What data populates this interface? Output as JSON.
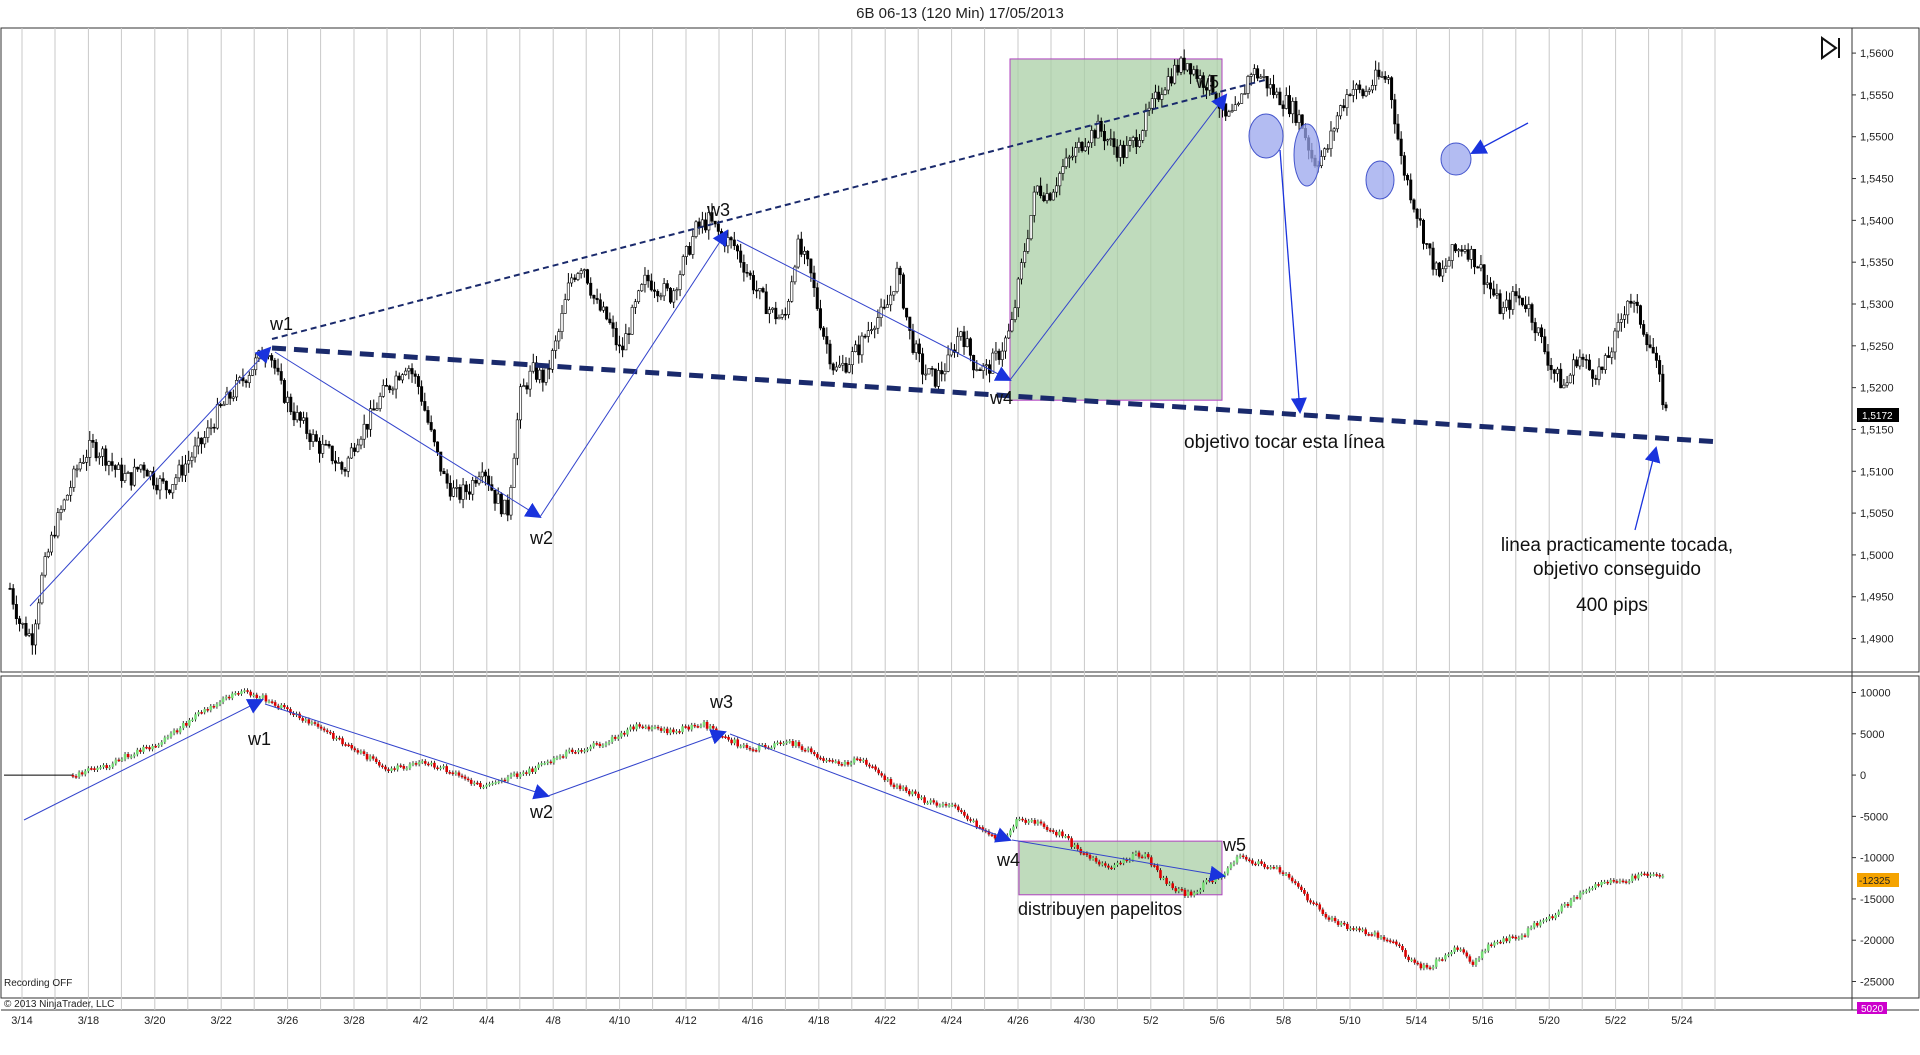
{
  "window": {
    "title": "6B 06-13 (120 Min)  17/05/2013",
    "recording": "Recording OFF",
    "copyright": "© 2013 NinjaTrader, LLC",
    "nav_icon": "jump-to-end-icon"
  },
  "colors": {
    "grid": "#c8c8c8",
    "candle_up": "#ffffff",
    "candle_down": "#000000",
    "trend_line": "#1a2a6c",
    "wave_line": "#3344cc",
    "arrow": "#1a33dd",
    "box_fill": "#a9cfa5",
    "box_stroke": "#b040c0",
    "ellipse": "#9aa6ee",
    "price_badge": "#000000",
    "vol_badge": "#f5a300",
    "bottom_badge": "#cc00cc",
    "hist_up": "#77dd77",
    "hist_down": "#dd0000"
  },
  "chart_data": [
    {
      "type": "candlestick",
      "instrument": "6B 06-13",
      "timeframe": "120 Min",
      "ylim": [
        1.486,
        1.563
      ],
      "y_ticks": [
        "1,4900",
        "1,4950",
        "1,5000",
        "1,5050",
        "1,5100",
        "1,5150",
        "1,5200",
        "1,5250",
        "1,5300",
        "1,5350",
        "1,5400",
        "1,5450",
        "1,5500",
        "1,5550",
        "1,5600"
      ],
      "y_tick_values": [
        1.49,
        1.495,
        1.5,
        1.505,
        1.51,
        1.515,
        1.52,
        1.525,
        1.53,
        1.535,
        1.54,
        1.545,
        1.55,
        1.555,
        1.56
      ],
      "last_price": "1,5172",
      "x_ticks": [
        "3/14",
        "3/18",
        "3/20",
        "3/22",
        "3/26",
        "3/28",
        "4/2",
        "4/4",
        "4/8",
        "4/10",
        "4/12",
        "4/16",
        "4/18",
        "4/22",
        "4/24",
        "4/26",
        "4/30",
        "5/2",
        "5/6",
        "5/8",
        "5/10",
        "5/14",
        "5/16",
        "5/20",
        "5/22",
        "5/24"
      ],
      "close_path": [
        [
          0,
          1.496
        ],
        [
          0.3,
          1.492
        ],
        [
          0.7,
          1.49
        ],
        [
          1,
          1.497
        ],
        [
          1.4,
          1.503
        ],
        [
          1.8,
          1.507
        ],
        [
          2.2,
          1.511
        ],
        [
          2.6,
          1.513
        ],
        [
          3,
          1.512
        ],
        [
          3.4,
          1.51
        ],
        [
          3.8,
          1.509
        ],
        [
          4.2,
          1.511
        ],
        [
          4.6,
          1.509
        ],
        [
          5,
          1.508
        ],
        [
          5.4,
          1.51
        ],
        [
          5.8,
          1.512
        ],
        [
          6.2,
          1.514
        ],
        [
          6.6,
          1.517
        ],
        [
          7,
          1.519
        ],
        [
          7.4,
          1.521
        ],
        [
          7.8,
          1.523
        ],
        [
          8.2,
          1.525
        ],
        [
          8.6,
          1.52
        ],
        [
          9,
          1.517
        ],
        [
          9.4,
          1.515
        ],
        [
          9.8,
          1.513
        ],
        [
          10.2,
          1.512
        ],
        [
          10.6,
          1.51
        ],
        [
          11,
          1.514
        ],
        [
          11.4,
          1.516
        ],
        [
          11.8,
          1.519
        ],
        [
          12.2,
          1.521
        ],
        [
          12.6,
          1.523
        ],
        [
          13,
          1.52
        ],
        [
          13.4,
          1.514
        ],
        [
          13.8,
          1.509
        ],
        [
          14.2,
          1.507
        ],
        [
          14.6,
          1.508
        ],
        [
          15,
          1.511
        ],
        [
          15.4,
          1.507
        ],
        [
          15.8,
          1.505
        ],
        [
          16.2,
          1.519
        ],
        [
          16.6,
          1.522
        ],
        [
          17,
          1.521
        ],
        [
          17.4,
          1.526
        ],
        [
          17.8,
          1.533
        ],
        [
          18.2,
          1.535
        ],
        [
          18.6,
          1.53
        ],
        [
          19,
          1.528
        ],
        [
          19.4,
          1.524
        ],
        [
          19.8,
          1.529
        ],
        [
          20.2,
          1.533
        ],
        [
          20.6,
          1.532
        ],
        [
          21,
          1.531
        ],
        [
          21.4,
          1.535
        ],
        [
          21.8,
          1.539
        ],
        [
          22.2,
          1.54
        ],
        [
          22.6,
          1.538
        ],
        [
          23,
          1.537
        ],
        [
          23.4,
          1.534
        ],
        [
          23.8,
          1.531
        ],
        [
          24.2,
          1.529
        ],
        [
          24.6,
          1.528
        ],
        [
          25,
          1.537
        ],
        [
          25.4,
          1.534
        ],
        [
          25.8,
          1.527
        ],
        [
          26.2,
          1.522
        ],
        [
          26.6,
          1.523
        ],
        [
          27,
          1.525
        ],
        [
          27.4,
          1.528
        ],
        [
          27.8,
          1.529
        ],
        [
          28.2,
          1.534
        ],
        [
          28.6,
          1.526
        ],
        [
          29,
          1.522
        ],
        [
          29.4,
          1.521
        ],
        [
          29.8,
          1.523
        ],
        [
          30.2,
          1.527
        ],
        [
          30.6,
          1.523
        ],
        [
          31,
          1.522
        ],
        [
          31.4,
          1.524
        ],
        [
          31.8,
          1.527
        ],
        [
          32.2,
          1.536
        ],
        [
          32.6,
          1.544
        ],
        [
          33,
          1.543
        ],
        [
          33.4,
          1.546
        ],
        [
          33.8,
          1.548
        ],
        [
          34.2,
          1.55
        ],
        [
          34.6,
          1.551
        ],
        [
          35,
          1.549
        ],
        [
          35.4,
          1.548
        ],
        [
          35.8,
          1.55
        ],
        [
          36.2,
          1.553
        ],
        [
          36.6,
          1.556
        ],
        [
          37,
          1.558
        ],
        [
          37.4,
          1.559
        ],
        [
          37.8,
          1.557
        ],
        [
          38.2,
          1.556
        ],
        [
          38.6,
          1.552
        ],
        [
          39,
          1.553
        ],
        [
          39.4,
          1.558
        ],
        [
          39.8,
          1.557
        ],
        [
          40.2,
          1.555
        ],
        [
          40.6,
          1.554
        ],
        [
          41,
          1.552
        ],
        [
          41.4,
          1.547
        ],
        [
          41.8,
          1.548
        ],
        [
          42.2,
          1.553
        ],
        [
          42.6,
          1.556
        ],
        [
          43,
          1.555
        ],
        [
          43.4,
          1.557
        ],
        [
          43.8,
          1.557
        ],
        [
          44.2,
          1.547
        ],
        [
          44.6,
          1.542
        ],
        [
          45,
          1.537
        ],
        [
          45.4,
          1.533
        ],
        [
          45.8,
          1.536
        ],
        [
          46.2,
          1.537
        ],
        [
          46.6,
          1.535
        ],
        [
          47,
          1.532
        ],
        [
          47.4,
          1.529
        ],
        [
          47.8,
          1.531
        ],
        [
          48.2,
          1.53
        ],
        [
          48.6,
          1.526
        ],
        [
          49,
          1.522
        ],
        [
          49.4,
          1.52
        ],
        [
          49.8,
          1.524
        ],
        [
          50.2,
          1.522
        ],
        [
          50.6,
          1.522
        ],
        [
          51,
          1.526
        ],
        [
          51.4,
          1.531
        ],
        [
          51.8,
          1.528
        ],
        [
          52.2,
          1.524
        ],
        [
          52.6,
          1.517
        ]
      ],
      "annotations": {
        "w1": "w1",
        "w2": "w2",
        "w3": "w3",
        "w4": "w4",
        "w5": "w5",
        "target_label": "objetivo tocar esta línea",
        "result_line1": "linea practicamente tocada,",
        "result_line2": "objetivo conseguido",
        "pips": "400 pips"
      }
    },
    {
      "type": "histogram",
      "ylim": [
        -27000,
        12000
      ],
      "y_ticks": [
        "10000",
        "5000",
        "0",
        "-5000",
        "-10000",
        "-15000",
        "-20000",
        "-25000"
      ],
      "y_tick_values": [
        10000,
        5000,
        0,
        -5000,
        -10000,
        -15000,
        -20000,
        -25000
      ],
      "last_value": "-12325",
      "bottom_badge": "5020",
      "path": [
        [
          0,
          0
        ],
        [
          1,
          0
        ],
        [
          2,
          0
        ],
        [
          2.5,
          500
        ],
        [
          3,
          1000
        ],
        [
          3.5,
          2000
        ],
        [
          4,
          2800
        ],
        [
          4.5,
          3500
        ],
        [
          5,
          4500
        ],
        [
          5.5,
          6000
        ],
        [
          6,
          7500
        ],
        [
          6.5,
          8500
        ],
        [
          7,
          9500
        ],
        [
          7.5,
          10000
        ],
        [
          8,
          9500
        ],
        [
          8.5,
          8500
        ],
        [
          9,
          7500
        ],
        [
          9.5,
          6500
        ],
        [
          10,
          5500
        ],
        [
          10.5,
          4000
        ],
        [
          11,
          3000
        ],
        [
          11.5,
          1800
        ],
        [
          12,
          800
        ],
        [
          12.5,
          1000
        ],
        [
          13,
          1800
        ],
        [
          13.5,
          1200
        ],
        [
          14,
          400
        ],
        [
          14.5,
          -500
        ],
        [
          15,
          -1500
        ],
        [
          15.5,
          -1000
        ],
        [
          16,
          0
        ],
        [
          16.5,
          500
        ],
        [
          17,
          1500
        ],
        [
          17.5,
          2500
        ],
        [
          18,
          3000
        ],
        [
          18.5,
          3500
        ],
        [
          19,
          4200
        ],
        [
          19.5,
          5200
        ],
        [
          20,
          6000
        ],
        [
          20.5,
          5800
        ],
        [
          21,
          5200
        ],
        [
          21.5,
          5800
        ],
        [
          22,
          6200
        ],
        [
          22.5,
          5000
        ],
        [
          23,
          4000
        ],
        [
          23.5,
          3200
        ],
        [
          24,
          3500
        ],
        [
          24.5,
          4000
        ],
        [
          25,
          3800
        ],
        [
          25.5,
          2500
        ],
        [
          26,
          1500
        ],
        [
          26.5,
          1500
        ],
        [
          27,
          2000
        ],
        [
          27.5,
          500
        ],
        [
          28,
          -1000
        ],
        [
          28.5,
          -2000
        ],
        [
          29,
          -3000
        ],
        [
          29.5,
          -3500
        ],
        [
          30,
          -4000
        ],
        [
          30.5,
          -5500
        ],
        [
          31,
          -7000
        ],
        [
          31.5,
          -8000
        ],
        [
          32,
          -5500
        ],
        [
          32.5,
          -5500
        ],
        [
          33,
          -6500
        ],
        [
          33.5,
          -7500
        ],
        [
          34,
          -9500
        ],
        [
          34.5,
          -10500
        ],
        [
          35,
          -11000
        ],
        [
          35.5,
          -10000
        ],
        [
          36,
          -9500
        ],
        [
          36.5,
          -12000
        ],
        [
          37,
          -14000
        ],
        [
          37.5,
          -14500
        ],
        [
          38,
          -13000
        ],
        [
          38.5,
          -12000
        ],
        [
          39,
          -10000
        ],
        [
          39.5,
          -10500
        ],
        [
          40,
          -11000
        ],
        [
          40.5,
          -12000
        ],
        [
          41,
          -14000
        ],
        [
          41.5,
          -16000
        ],
        [
          42,
          -17500
        ],
        [
          42.5,
          -18500
        ],
        [
          43,
          -19000
        ],
        [
          43.5,
          -19500
        ],
        [
          44,
          -20500
        ],
        [
          44.5,
          -22500
        ],
        [
          45,
          -23500
        ],
        [
          45.5,
          -22000
        ],
        [
          46,
          -21000
        ],
        [
          46.5,
          -23000
        ],
        [
          47,
          -20500
        ],
        [
          47.5,
          -20000
        ],
        [
          48,
          -19500
        ],
        [
          48.5,
          -18000
        ],
        [
          49,
          -17000
        ],
        [
          49.5,
          -15500
        ],
        [
          50,
          -14000
        ],
        [
          50.5,
          -13000
        ],
        [
          51,
          -13000
        ],
        [
          51.5,
          -12500
        ],
        [
          52,
          -12000
        ],
        [
          52.5,
          -12325
        ]
      ],
      "annotations": {
        "w1": "w1",
        "w2": "w2",
        "w3": "w3",
        "w4": "w4",
        "w5": "w5",
        "distribution_label": "distribuyen papelitos"
      }
    }
  ]
}
